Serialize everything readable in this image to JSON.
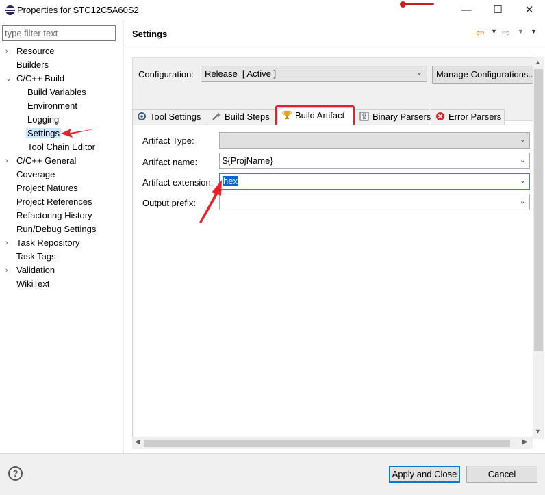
{
  "window": {
    "title": "Properties for STC12C5A60S2",
    "minimize": "—",
    "maximize": "☐",
    "close": "✕"
  },
  "filter": {
    "placeholder": "type filter text",
    "value": ""
  },
  "tree": [
    {
      "label": "Resource",
      "expandable": true
    },
    {
      "label": "Builders",
      "expandable": false
    },
    {
      "label": "C/C++ Build",
      "expandable": true,
      "expanded": true
    },
    {
      "label": "Build Variables",
      "child": true
    },
    {
      "label": "Environment",
      "child": true
    },
    {
      "label": "Logging",
      "child": true
    },
    {
      "label": "Settings",
      "child": true,
      "selected": true
    },
    {
      "label": "Tool Chain Editor",
      "child": true
    },
    {
      "label": "C/C++ General",
      "expandable": true
    },
    {
      "label": "Coverage",
      "expandable": false
    },
    {
      "label": "Project Natures",
      "expandable": false
    },
    {
      "label": "Project References",
      "expandable": false
    },
    {
      "label": "Refactoring History",
      "expandable": false
    },
    {
      "label": "Run/Debug Settings",
      "expandable": false
    },
    {
      "label": "Task Repository",
      "expandable": true
    },
    {
      "label": "Task Tags",
      "expandable": false
    },
    {
      "label": "Validation",
      "expandable": true
    },
    {
      "label": "WikiText",
      "expandable": false
    }
  ],
  "header": {
    "title": "Settings"
  },
  "configuration": {
    "label": "Configuration:",
    "value": "Release  [ Active ]",
    "manage_button": "Manage Configurations..."
  },
  "tabs": [
    {
      "label": "Tool Settings",
      "icon": "gear-icon"
    },
    {
      "label": "Build Steps",
      "icon": "wand-icon"
    },
    {
      "label": "Build Artifact",
      "icon": "trophy-icon",
      "active": true
    },
    {
      "label": "Binary Parsers",
      "icon": "binary-icon"
    },
    {
      "label": "Error Parsers",
      "icon": "error-icon"
    }
  ],
  "fields": {
    "artifact_type": {
      "label": "Artifact Type:",
      "value": ""
    },
    "artifact_name": {
      "label": "Artifact name:",
      "value": "${ProjName}"
    },
    "artifact_extension": {
      "label": "Artifact extension:",
      "value": "hex"
    },
    "output_prefix": {
      "label": "Output prefix:",
      "value": ""
    }
  },
  "buttons": {
    "help": "?",
    "apply_close": "Apply and Close",
    "cancel": "Cancel"
  },
  "colors": {
    "annotation_red": "#e8202a",
    "selection_blue": "#0a64d6",
    "accent": "#0078d7"
  }
}
